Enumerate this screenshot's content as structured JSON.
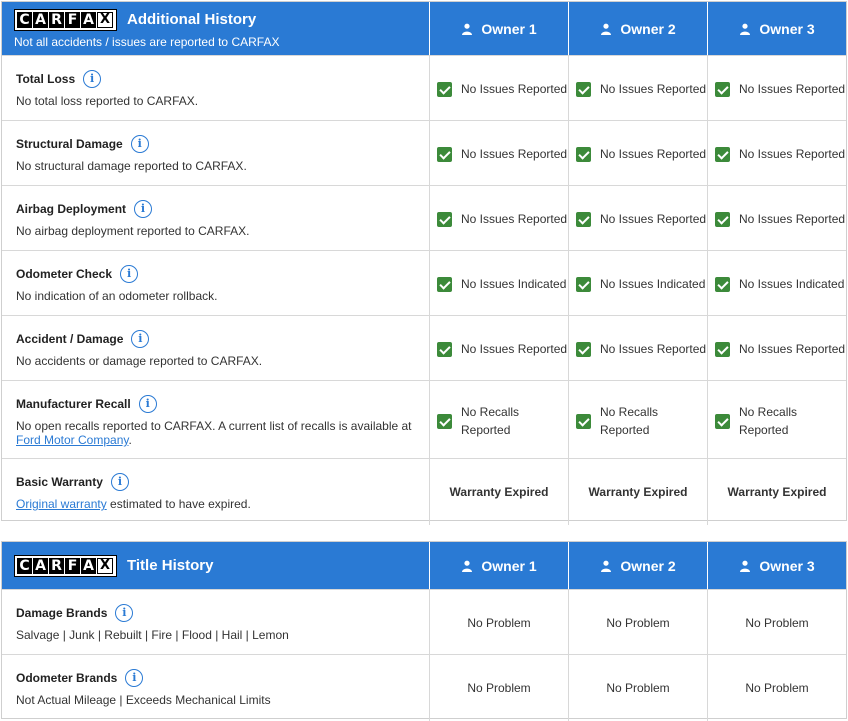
{
  "logo_text": "CARFAX",
  "additional": {
    "title": "Additional History",
    "subtitle": "Not all accidents / issues are reported to CARFAX",
    "owners": [
      "Owner 1",
      "Owner 2",
      "Owner 3"
    ],
    "rows": [
      {
        "title": "Total Loss",
        "desc": "No total loss reported to CARFAX.",
        "values": [
          "No Issues Reported",
          "No Issues Reported",
          "No Issues Reported"
        ]
      },
      {
        "title": "Structural Damage",
        "desc": "No structural damage reported to CARFAX.",
        "values": [
          "No Issues Reported",
          "No Issues Reported",
          "No Issues Reported"
        ]
      },
      {
        "title": "Airbag Deployment",
        "desc": "No airbag deployment reported to CARFAX.",
        "values": [
          "No Issues Reported",
          "No Issues Reported",
          "No Issues Reported"
        ]
      },
      {
        "title": "Odometer Check",
        "desc": "No indication of an odometer rollback.",
        "values": [
          "No Issues Indicated",
          "No Issues Indicated",
          "No Issues Indicated"
        ]
      },
      {
        "title": "Accident / Damage",
        "desc": "No accidents or damage reported to CARFAX.",
        "values": [
          "No Issues Reported",
          "No Issues Reported",
          "No Issues Reported"
        ]
      },
      {
        "title": "Manufacturer Recall",
        "desc": "No open recalls reported to CARFAX. A current list of recalls is available at",
        "link": "Ford Motor Company",
        "desc_after": ".",
        "values": [
          "No Recalls Reported",
          "No Recalls Reported",
          "No Recalls Reported"
        ]
      },
      {
        "title": "Basic Warranty",
        "link": "Original warranty",
        "desc_after": " estimated to have expired.",
        "values": [
          "Warranty Expired",
          "Warranty Expired",
          "Warranty Expired"
        ]
      }
    ]
  },
  "title_history": {
    "title": "Title History",
    "owners": [
      "Owner 1",
      "Owner 2",
      "Owner 3"
    ],
    "rows": [
      {
        "title": "Damage Brands",
        "desc": "Salvage | Junk | Rebuilt | Fire | Flood | Hail | Lemon",
        "values": [
          "No Problem",
          "No Problem",
          "No Problem"
        ]
      },
      {
        "title": "Odometer Brands",
        "desc": "Not Actual Mileage | Exceeds Mechanical Limits",
        "values": [
          "No Problem",
          "No Problem",
          "No Problem"
        ]
      }
    ]
  },
  "colors": {
    "header_blue": "#2a7ad4",
    "check_green": "#3c8a3a"
  }
}
